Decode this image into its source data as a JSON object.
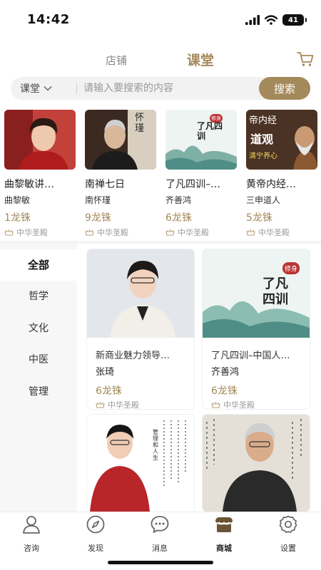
{
  "status_bar": {
    "time": "14:42",
    "battery": "41"
  },
  "header": {
    "tabs": [
      {
        "label": "店铺"
      },
      {
        "label": "课堂"
      }
    ]
  },
  "search": {
    "scope": "课堂",
    "placeholder": "请输入要搜索的内容",
    "button": "搜索"
  },
  "featured": [
    {
      "title": "曲黎敏讲…",
      "author": "曲黎敏",
      "price": "1龙铢",
      "store": "中华圣殿"
    },
    {
      "title": "南禅七日",
      "author": "南怀瑾",
      "price": "9龙铢",
      "store": "中华圣殿"
    },
    {
      "title": "了凡四训–…",
      "author": "齐善鸿",
      "price": "6龙铢",
      "store": "中华圣殿"
    },
    {
      "title": "黄帝内经…",
      "author": "三申道人",
      "price": "5龙铢",
      "store": "中华圣殿"
    }
  ],
  "featured_image_text": {
    "card2_calligraphy": "怀瑾",
    "card3_poster": "了凡四训",
    "card3_badge": "修身",
    "card4_line1": "帝内经",
    "card4_line2": "道观",
    "card4_line3": "清宁养心"
  },
  "sidebar": {
    "items": [
      {
        "label": "全部"
      },
      {
        "label": "哲学"
      },
      {
        "label": "文化"
      },
      {
        "label": "中医"
      },
      {
        "label": "管理"
      }
    ]
  },
  "grid": [
    {
      "title": "新商业魅力领导…",
      "author": "张琦",
      "price": "6龙铢",
      "store": "中华圣殿"
    },
    {
      "title": "了凡四训–中国人…",
      "author": "齐善鸿",
      "price": "6龙铢",
      "store": "中华圣殿"
    },
    {
      "title": "",
      "author": "",
      "price": "",
      "store": ""
    },
    {
      "title": "",
      "author": "",
      "price": "",
      "store": ""
    }
  ],
  "grid_image_text": {
    "card2_poster": "了凡四训",
    "card2_badge": "修身",
    "card3_quote": "管理和人生"
  },
  "bottom_nav": {
    "items": [
      {
        "label": "咨询"
      },
      {
        "label": "发现"
      },
      {
        "label": "消息"
      },
      {
        "label": "商城"
      },
      {
        "label": "设置"
      }
    ]
  },
  "colors": {
    "accent": "#a4895a",
    "sidebar_bg": "#f7f7f7",
    "search_bg": "#f2f2f2"
  }
}
